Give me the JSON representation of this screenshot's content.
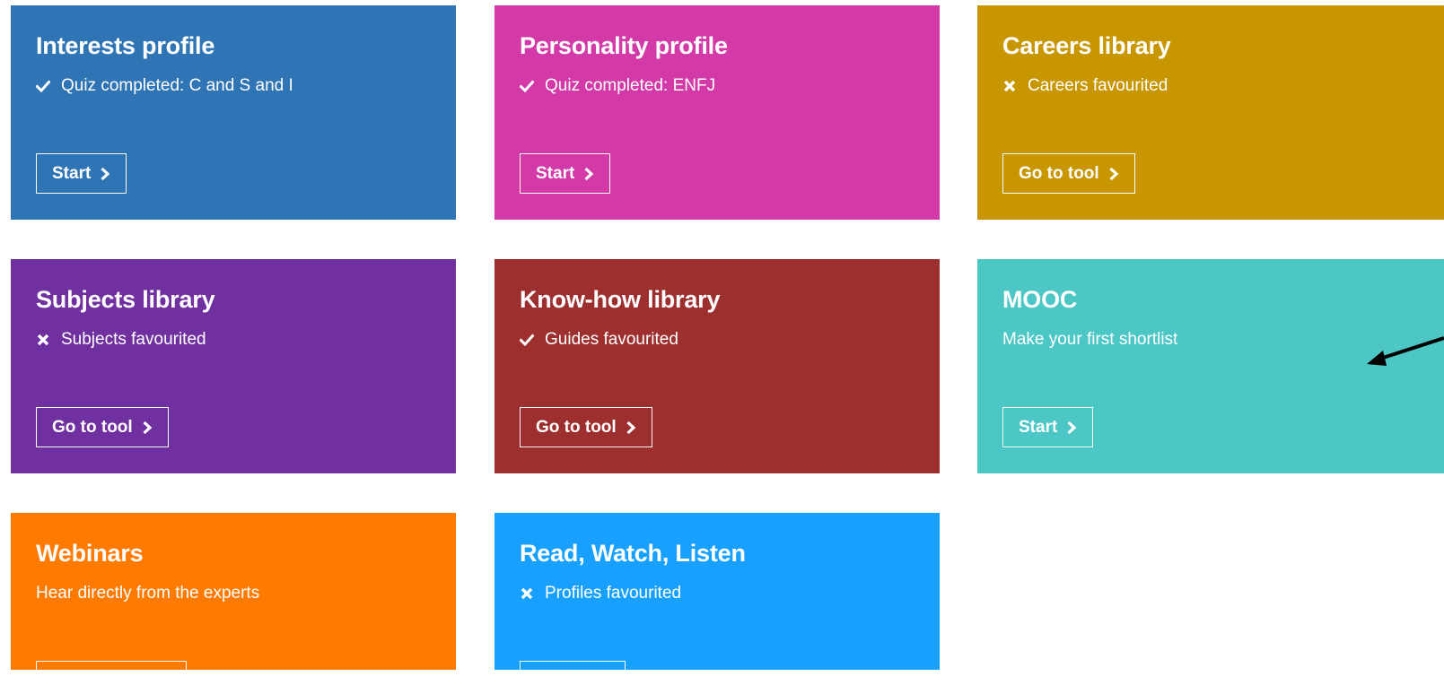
{
  "tiles": [
    {
      "title": "Interests profile",
      "status": "Quiz completed: C and S and I",
      "status_icon": "check-icon",
      "button": "Start",
      "color": "#2f75b5"
    },
    {
      "title": "Personality profile",
      "status": "Quiz completed: ENFJ",
      "status_icon": "check-icon",
      "button": "Start",
      "color": "#d33aa8"
    },
    {
      "title": "Careers library",
      "status": "Careers favourited",
      "status_icon": "cross-icon",
      "button": "Go to tool",
      "color": "#c79600"
    },
    {
      "title": "Subjects library",
      "status": "Subjects favourited",
      "status_icon": "cross-icon",
      "button": "Go to tool",
      "color": "#7030a0"
    },
    {
      "title": "Know-how library",
      "status": "Guides favourited",
      "status_icon": "check-icon",
      "button": "Go to tool",
      "color": "#9e2f2f"
    },
    {
      "title": "MOOC",
      "status": "Make your first shortlist",
      "status_icon": "",
      "button": "Start",
      "color": "#4dc6c6"
    },
    {
      "title": "Webinars",
      "status": "Hear directly from the experts",
      "status_icon": "",
      "button": "",
      "color": "#ff7a00"
    },
    {
      "title": "Read, Watch, Listen",
      "status": "Profiles favourited",
      "status_icon": "cross-icon",
      "button": "",
      "color": "#18a0ff"
    }
  ],
  "annotation": {
    "icon": "arrow-icon",
    "color": "#000000"
  }
}
